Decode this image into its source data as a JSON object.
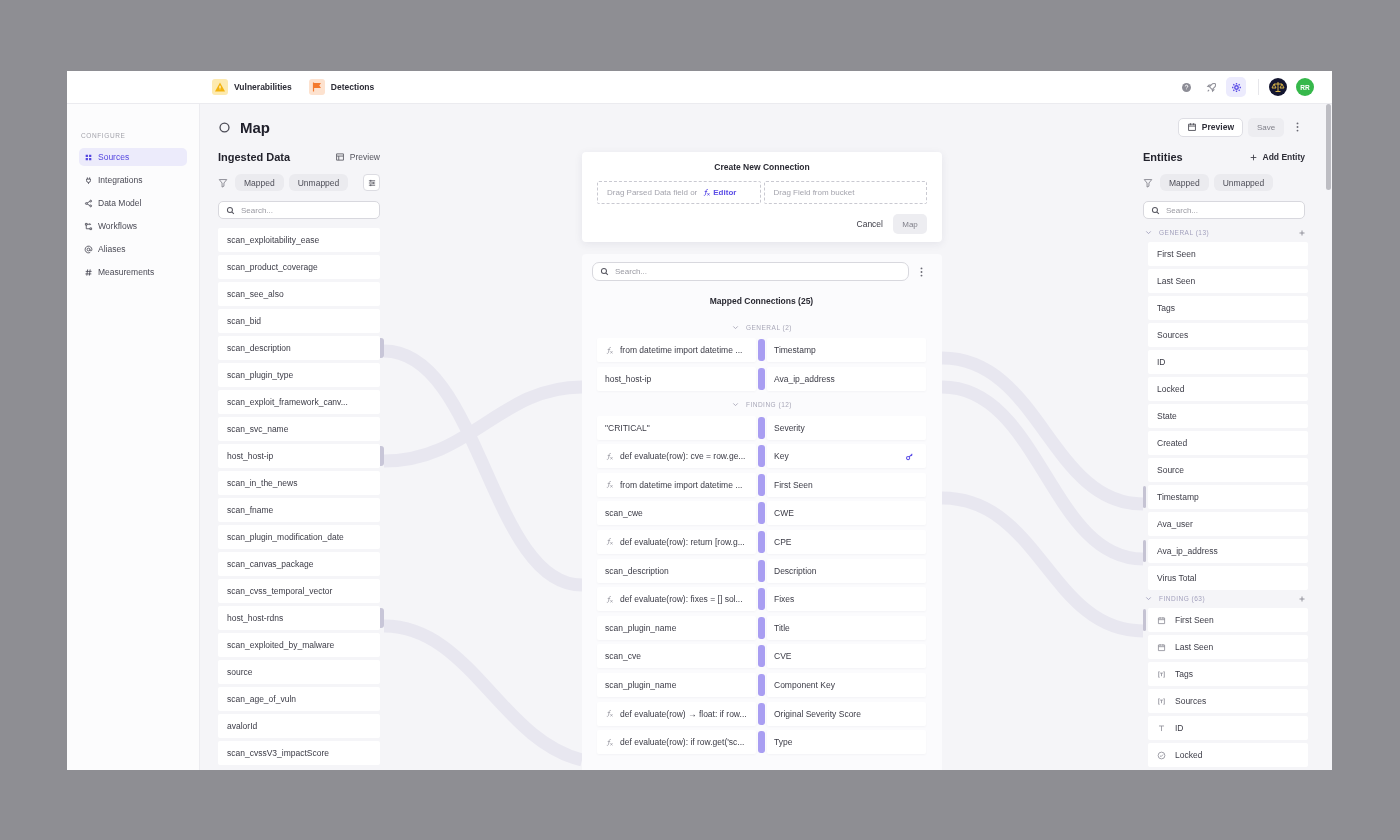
{
  "top_bar": {
    "apps": [
      {
        "label": "Vulnerabilities",
        "kind": "warning"
      },
      {
        "label": "Detections",
        "kind": "flag"
      }
    ],
    "tools": [
      {
        "kind": "help",
        "selected": false
      },
      {
        "kind": "rocket",
        "selected": false
      },
      {
        "kind": "settings",
        "selected": true
      }
    ],
    "avatars": [
      {
        "kind": "logo"
      },
      {
        "kind": "initials",
        "text": "RR"
      }
    ]
  },
  "sidebar": {
    "section": "CONFIGURE",
    "items": [
      {
        "label": "Sources",
        "kind": "grid",
        "selected": true
      },
      {
        "label": "Integrations",
        "kind": "plug",
        "selected": false
      },
      {
        "label": "Data Model",
        "kind": "nodes",
        "selected": false
      },
      {
        "label": "Workflows",
        "kind": "flow",
        "selected": false
      },
      {
        "label": "Aliases",
        "kind": "at",
        "selected": false
      },
      {
        "label": "Measurements",
        "kind": "hash",
        "selected": false
      }
    ]
  },
  "page": {
    "title": "Map",
    "preview": "Preview",
    "save": {
      "label": "Save",
      "disabled": true
    }
  },
  "ingested": {
    "title": "Ingested Data",
    "preview": "Preview",
    "filters": [
      "Mapped",
      "Unmapped"
    ],
    "search": {
      "placeholder": "Search..."
    },
    "items": [
      {
        "label": "scan_exploitability_ease",
        "mapped": false
      },
      {
        "label": "scan_product_coverage",
        "mapped": false
      },
      {
        "label": "scan_see_also",
        "mapped": false
      },
      {
        "label": "scan_bid",
        "mapped": false
      },
      {
        "label": "scan_description",
        "mapped": true
      },
      {
        "label": "scan_plugin_type",
        "mapped": false
      },
      {
        "label": "scan_exploit_framework_canv...",
        "mapped": false
      },
      {
        "label": "scan_svc_name",
        "mapped": false
      },
      {
        "label": "host_host-ip",
        "mapped": true
      },
      {
        "label": "scan_in_the_news",
        "mapped": false
      },
      {
        "label": "scan_fname",
        "mapped": false
      },
      {
        "label": "scan_plugin_modification_date",
        "mapped": false
      },
      {
        "label": "scan_canvas_package",
        "mapped": false
      },
      {
        "label": "scan_cvss_temporal_vector",
        "mapped": false
      },
      {
        "label": "host_host-rdns",
        "mapped": true
      },
      {
        "label": "scan_exploited_by_malware",
        "mapped": false
      },
      {
        "label": "source",
        "mapped": false
      },
      {
        "label": "scan_age_of_vuln",
        "mapped": false
      },
      {
        "label": "avalorId",
        "mapped": false
      },
      {
        "label": "scan_cvssV3_impactScore",
        "mapped": false
      }
    ]
  },
  "new_connection": {
    "title": "Create New Connection",
    "source_hint": "Drag Parsed Data field or",
    "editor_link": "Editor",
    "target_hint": "Drag Field from bucket",
    "cancel": "Cancel",
    "map": {
      "label": "Map",
      "disabled": true
    }
  },
  "mapped": {
    "search": {
      "placeholder": "Search..."
    },
    "title": "Mapped Connections (25)",
    "groups": [
      {
        "label": "GENERAL (2)",
        "expanded": true,
        "rows": [
          {
            "kind": "formula",
            "source": "from datetime import datetime ...",
            "target": "Timestamp",
            "primary_key": false
          },
          {
            "kind": "field",
            "source": "host_host-ip",
            "target": "Ava_ip_address",
            "primary_key": false
          }
        ]
      },
      {
        "label": "FINDING (12)",
        "expanded": true,
        "rows": [
          {
            "kind": "field",
            "source": "\"CRITICAL\"",
            "target": "Severity",
            "primary_key": false
          },
          {
            "kind": "formula",
            "source": "def evaluate(row): cve = row.ge...",
            "target": "Key",
            "primary_key": true
          },
          {
            "kind": "formula",
            "source": "from datetime import datetime ...",
            "target": "First Seen",
            "primary_key": false
          },
          {
            "kind": "field",
            "source": "scan_cwe",
            "target": "CWE",
            "primary_key": false
          },
          {
            "kind": "formula",
            "source": "def evaluate(row): return [row.g...",
            "target": "CPE",
            "primary_key": false
          },
          {
            "kind": "field",
            "source": "scan_description",
            "target": "Description",
            "primary_key": false
          },
          {
            "kind": "formula",
            "source": "def evaluate(row): fixes = [] sol...",
            "target": "Fixes",
            "primary_key": false
          },
          {
            "kind": "field",
            "source": "scan_plugin_name",
            "target": "Title",
            "primary_key": false
          },
          {
            "kind": "field",
            "source": "scan_cve",
            "target": "CVE",
            "primary_key": false
          },
          {
            "kind": "field",
            "source": "scan_plugin_name",
            "target": "Component Key",
            "primary_key": false
          },
          {
            "kind": "formula",
            "source": "def evaluate(row) → float: if row...",
            "target": "Original Severity Score",
            "primary_key": false
          },
          {
            "kind": "formula",
            "source": "def evaluate(row): if row.get('sc...",
            "target": "Type",
            "primary_key": false
          }
        ]
      }
    ]
  },
  "entities": {
    "title": "Entities",
    "add": "Add Entity",
    "filters": [
      "Mapped",
      "Unmapped"
    ],
    "search": {
      "placeholder": "Search..."
    },
    "groups": [
      {
        "label": "GENERAL (13)",
        "expanded": true,
        "items": [
          {
            "label": "First Seen",
            "mapped": false
          },
          {
            "label": "Last Seen",
            "mapped": false
          },
          {
            "label": "Tags",
            "mapped": false
          },
          {
            "label": "Sources",
            "mapped": false
          },
          {
            "label": "ID",
            "mapped": false
          },
          {
            "label": "Locked",
            "mapped": false
          },
          {
            "label": "State",
            "mapped": false
          },
          {
            "label": "Created",
            "mapped": false
          },
          {
            "label": "Source",
            "mapped": false
          },
          {
            "label": "Timestamp",
            "mapped": true
          },
          {
            "label": "Ava_user",
            "mapped": false
          },
          {
            "label": "Ava_ip_address",
            "mapped": true
          },
          {
            "label": "Virus Total",
            "mapped": false
          }
        ]
      },
      {
        "label": "FINDING (63)",
        "expanded": true,
        "items": [
          {
            "label": "First Seen",
            "kind": "date",
            "mapped": true
          },
          {
            "label": "Last Seen",
            "kind": "date",
            "mapped": false
          },
          {
            "label": "Tags",
            "kind": "tags",
            "mapped": false
          },
          {
            "label": "Sources",
            "kind": "tags",
            "mapped": false
          },
          {
            "label": "ID",
            "kind": "text",
            "mapped": false
          },
          {
            "label": "Locked",
            "kind": "boolean",
            "mapped": false
          }
        ]
      }
    ]
  }
}
